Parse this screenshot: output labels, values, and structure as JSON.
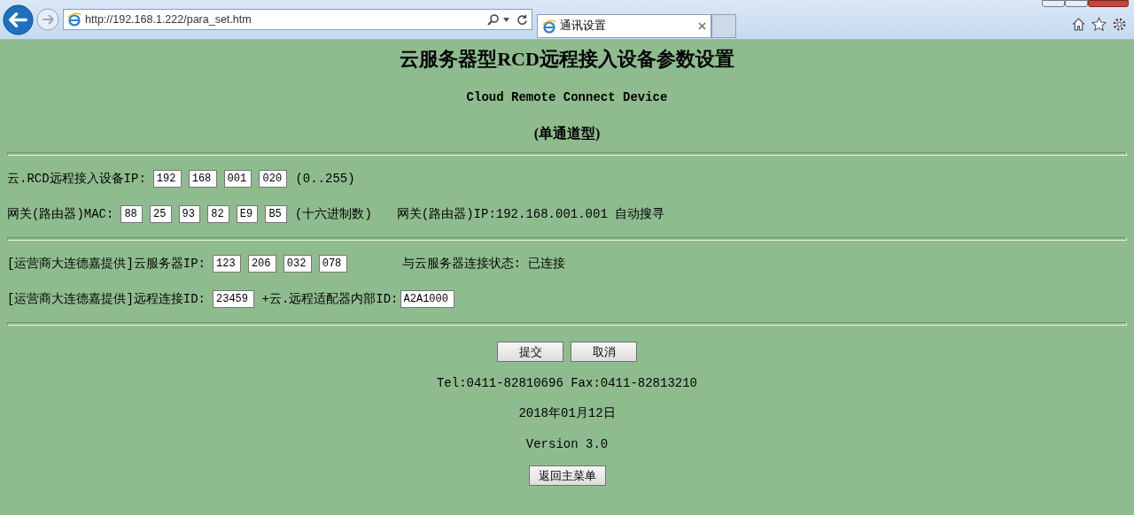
{
  "browser": {
    "address": "http://192.168.1.222/para_set.htm",
    "tab_title": "通讯设置"
  },
  "page": {
    "title": "云服务器型RCD远程接入设备参数设置",
    "subtitle": "Cloud Remote Connect Device",
    "model": "(单通道型)"
  },
  "sections": [
    {
      "rows": [
        {
          "label": "云.RCD远程接入设备IP:",
          "fields": [
            "192",
            "168",
            "001",
            "020"
          ],
          "hint": "(0..255)"
        },
        {
          "label": "网关(路由器)MAC:",
          "fields": [
            "88",
            "25",
            "93",
            "82",
            "E9",
            "B5"
          ],
          "hint": "(十六进制数)",
          "info": "网关(路由器)IP:192.168.001.001 自动搜寻"
        }
      ]
    },
    {
      "rows": [
        {
          "label": "[运营商大连德嘉提供]云服务器IP:",
          "fields": [
            "123",
            "206",
            "032",
            "078"
          ],
          "status": "与云服务器连接状态: 已连接"
        },
        {
          "label": "[运营商大连德嘉提供]远程连接ID:",
          "fields": [
            "23459"
          ],
          "suffix": {
            "label": "+云.远程适配器内部ID:",
            "field": "A2A1000"
          }
        }
      ]
    }
  ],
  "buttons": [
    "提交",
    "取消"
  ],
  "footer": {
    "contact": "Tel:0411-82810696 Fax:0411-82813210",
    "date": "2018年01月12日",
    "version": "Version 3.0"
  },
  "back_button": "返回主菜单"
}
